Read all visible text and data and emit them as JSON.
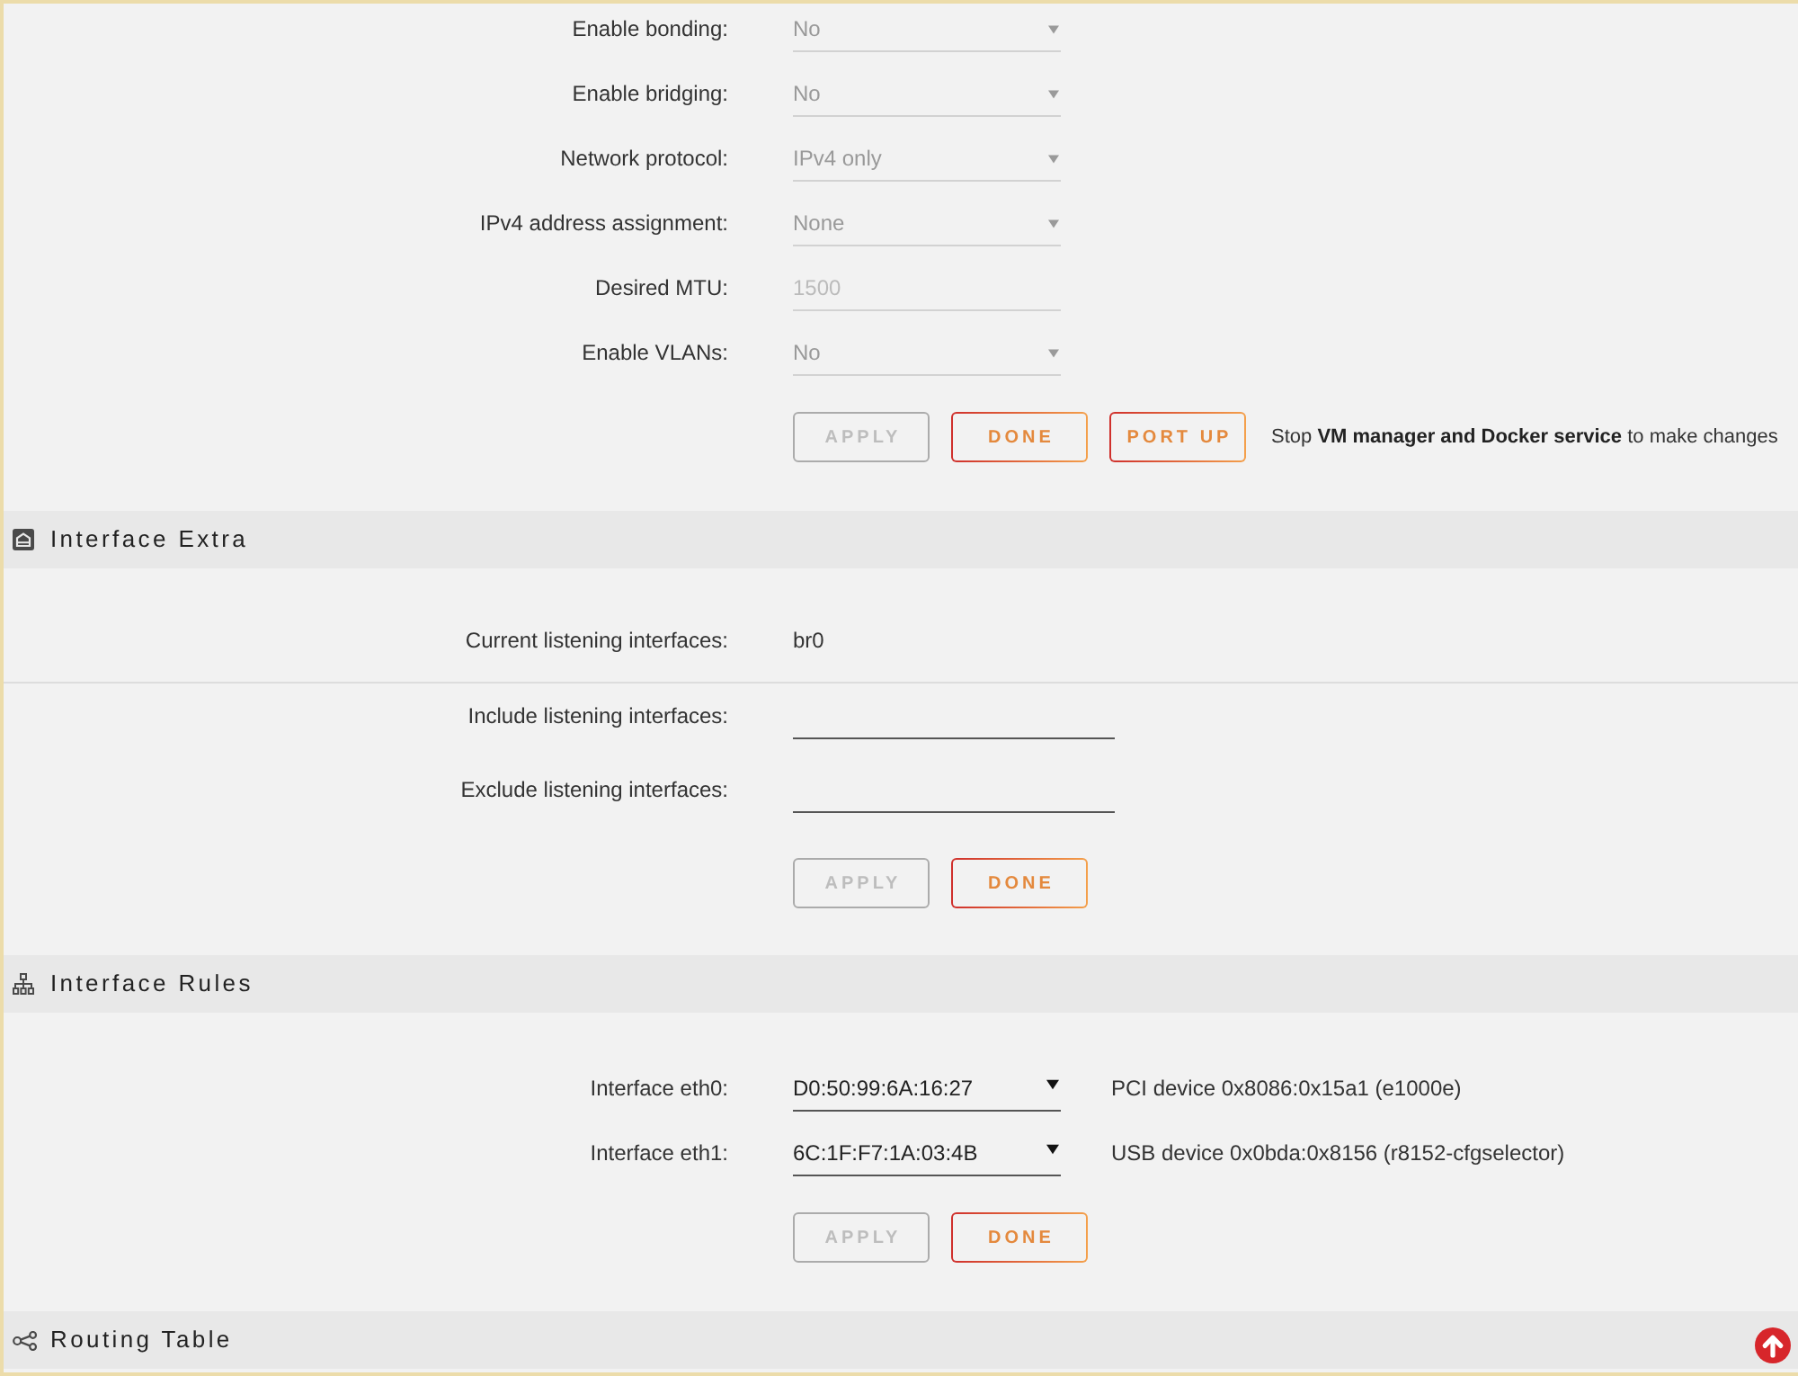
{
  "network_settings": {
    "fields": [
      {
        "label": "Enable bonding:",
        "kind": "select",
        "value": "No",
        "disabled": true
      },
      {
        "label": "Enable bridging:",
        "kind": "select",
        "value": "No",
        "disabled": true
      },
      {
        "label": "Network protocol:",
        "kind": "select",
        "value": "IPv4 only",
        "disabled": true
      },
      {
        "label": "IPv4 address assignment:",
        "kind": "select",
        "value": "None",
        "disabled": true
      },
      {
        "label": "Desired MTU:",
        "kind": "text",
        "value": "1500",
        "disabled": true
      },
      {
        "label": "Enable VLANs:",
        "kind": "select",
        "value": "No",
        "disabled": true
      }
    ],
    "buttons": [
      {
        "label": "APPLY",
        "disabled": true
      },
      {
        "label": "DONE",
        "disabled": false
      },
      {
        "label": "PORT UP",
        "disabled": false
      }
    ],
    "notice": "Stop **VM manager and Docker service** to make changes"
  },
  "interface_extra": {
    "title": "Interface Extra",
    "info_rows": [
      {
        "label": "Current listening interfaces:",
        "value": "br0"
      }
    ],
    "fields": [
      {
        "label": "Include listening interfaces:",
        "kind": "text",
        "disabled": false
      },
      {
        "label": "Exclude listening interfaces:",
        "kind": "text",
        "disabled": false
      }
    ],
    "buttons": [
      {
        "label": "APPLY",
        "disabled": true
      },
      {
        "label": "DONE",
        "disabled": false
      }
    ]
  },
  "interface_rules": {
    "title": "Interface Rules",
    "fields": [
      {
        "label": "Interface eth0:",
        "kind": "select",
        "value": "D0:50:99:6A:16:27",
        "disabled": false,
        "description": "PCI device 0x8086:0x15a1 (e1000e)"
      },
      {
        "label": "Interface eth1:",
        "kind": "select",
        "value": "6C:1F:F7:1A:03:4B",
        "disabled": false,
        "description": "USB device 0x0bda:0x8156 (r8152-cfgselector)"
      }
    ],
    "buttons": [
      {
        "label": "APPLY",
        "disabled": true
      },
      {
        "label": "DONE",
        "disabled": false
      }
    ]
  },
  "routing_table": {
    "title": "Routing Table"
  }
}
